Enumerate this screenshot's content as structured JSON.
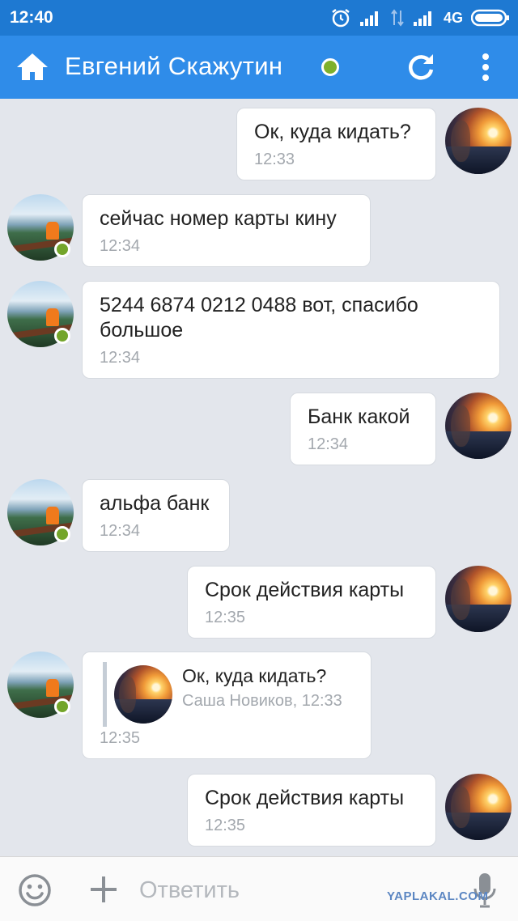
{
  "status_bar": {
    "time": "12:40",
    "network": "4G"
  },
  "header": {
    "contact_name": "Евгений Скажутин"
  },
  "messages": [
    {
      "text": "Ок, куда кидать?",
      "time": "12:33"
    },
    {
      "text": "сейчас номер карты кину",
      "time": "12:34"
    },
    {
      "text_line1": "5244 6874 0212 0488 вот, спасибо",
      "text_line2": "большое",
      "time": "12:34"
    },
    {
      "text": "Банк какой",
      "time": "12:34"
    },
    {
      "text": "альфа банк",
      "time": "12:34"
    },
    {
      "text": "Срок действия карты",
      "time": "12:35"
    },
    {
      "quote_text": "Ок, куда кидать?",
      "quote_meta": "Саша Новиков, 12:33",
      "time": "12:35"
    },
    {
      "text": "Срок действия карты",
      "time": "12:35"
    }
  ],
  "composer": {
    "placeholder": "Ответить"
  },
  "watermark": "YAPLAKAL.COM",
  "colors": {
    "status_bar": "#1e79d2",
    "app_bar": "#2f8ce9",
    "background": "#e3e6ec",
    "online": "#73a52a"
  }
}
